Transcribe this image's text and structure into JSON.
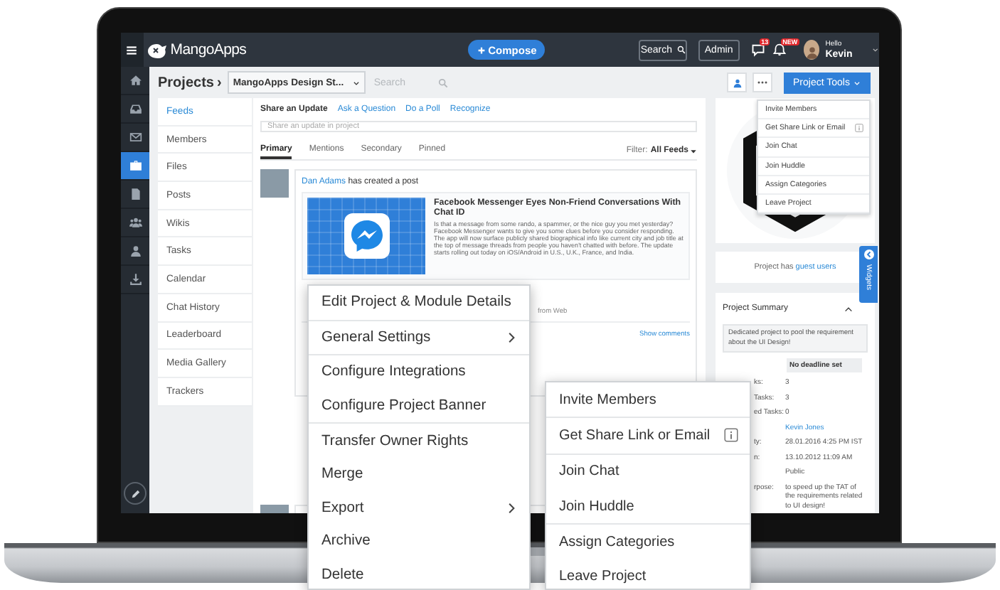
{
  "top_bar": {
    "logo": "MangoApps",
    "compose": "Compose",
    "search": "Search",
    "admin": "Admin",
    "messages_badge": "13",
    "alerts_badge": "NEW",
    "greeting": "Hello",
    "user_name": "Kevin"
  },
  "left_nav": [
    {
      "kind": "home",
      "selected": false
    },
    {
      "kind": "inbox",
      "selected": false
    },
    {
      "kind": "mail",
      "selected": false
    },
    {
      "kind": "briefcase",
      "selected": true
    },
    {
      "kind": "document",
      "selected": false
    },
    {
      "kind": "group",
      "selected": false
    },
    {
      "kind": "person",
      "selected": false
    },
    {
      "kind": "download",
      "selected": false
    }
  ],
  "project_header": {
    "title": "Projects",
    "separator": "›",
    "project": "MangoApps Design St...",
    "search_placeholder": "Search",
    "tools_button": "Project Tools"
  },
  "sidebar": {
    "items": [
      {
        "label": "Feeds",
        "selected": true
      },
      {
        "label": "Members",
        "selected": false
      },
      {
        "label": "Files",
        "selected": false
      },
      {
        "label": "Posts",
        "selected": false
      },
      {
        "label": "Wikis",
        "selected": false
      },
      {
        "label": "Tasks",
        "selected": false
      },
      {
        "label": "Calendar",
        "selected": false
      },
      {
        "label": "Chat History",
        "selected": false
      },
      {
        "label": "Leaderboard",
        "selected": false
      },
      {
        "label": "Media Gallery",
        "selected": false
      },
      {
        "label": "Trackers",
        "selected": false
      }
    ]
  },
  "composer": {
    "actions": [
      {
        "label": "Share an Update",
        "selected": true
      },
      {
        "label": "Ask a Question",
        "selected": false
      },
      {
        "label": "Do a Poll",
        "selected": false
      },
      {
        "label": "Recognize",
        "selected": false
      }
    ],
    "placeholder": "Share an update in project"
  },
  "feed_tabs": [
    {
      "label": "Primary",
      "selected": true
    },
    {
      "label": "Mentions",
      "selected": false
    },
    {
      "label": "Secondary",
      "selected": false
    },
    {
      "label": "Pinned",
      "selected": false
    }
  ],
  "filter": {
    "label": "Filter:",
    "value": "All Feeds"
  },
  "post": {
    "author": "Dan Adams",
    "action": "has created a post",
    "preview": {
      "title": "Facebook Messenger Eyes Non-Friend Conversations With Chat ID",
      "body": "Is that a message from some rando, a spammer, or the nice guy you met yesterday? Facebook Messenger wants to give you some clues before you consider responding. The app will now surface publicly shared biographical info like current city and job title at the top of message threads from people you haven't chatted with before. The update starts rolling out today on iOS/Android in U.S., U.K., France, and India."
    },
    "source": "from Web",
    "show_comments": "Show comments"
  },
  "right_panel": {
    "guest_text": "Project has",
    "guest_link": "guest users",
    "widgets_tab": "Widgets",
    "summary": {
      "title": "Project Summary",
      "expanded": true,
      "description": "Dedicated project to pool the requirement about the UI Design!",
      "deadline": "No deadline set",
      "rows": [
        {
          "label": "ks:",
          "value": "3",
          "kind": "text"
        },
        {
          "label": "Tasks:",
          "value": "3",
          "kind": "text"
        },
        {
          "label": "ed Tasks:",
          "value": "0",
          "kind": "text"
        },
        {
          "value": "Kevin Jones",
          "kind": "link"
        },
        {
          "label": "ty:",
          "value": "28.01.2016 4:25 PM IST",
          "kind": "text"
        },
        {
          "label": "n:",
          "value": "13.10.2012 11:09 AM",
          "kind": "text"
        },
        {
          "value": "Public",
          "kind": "text"
        },
        {
          "label": "rpose:",
          "value": "to speed up the TAT of the requirements related to UI design!",
          "kind": "text"
        }
      ]
    }
  },
  "tools_dropdown": {
    "items": [
      {
        "label": "Invite Members",
        "info": false
      },
      {
        "label": "Get Share Link or Email",
        "info": true
      },
      {
        "label": "Join Chat",
        "info": false
      },
      {
        "label": "Join Huddle",
        "info": false
      },
      {
        "label": "Assign Categories",
        "info": false
      },
      {
        "label": "Leave Project",
        "info": false
      }
    ]
  },
  "context_menu": {
    "groups": [
      [
        {
          "label": "Edit Project & Module Details",
          "submenu": false
        }
      ],
      [
        {
          "label": "General Settings",
          "submenu": true
        }
      ],
      [
        {
          "label": "Configure Integrations",
          "submenu": false
        },
        {
          "label": "Configure Project Banner",
          "submenu": false
        }
      ],
      [
        {
          "label": "Transfer Owner Rights",
          "submenu": false
        },
        {
          "label": "Merge",
          "submenu": false
        },
        {
          "label": "Export",
          "submenu": true
        },
        {
          "label": "Archive",
          "submenu": false
        },
        {
          "label": "Delete",
          "submenu": false
        }
      ]
    ]
  },
  "share_menu": {
    "groups": [
      [
        {
          "label": "Invite Members",
          "info": false
        }
      ],
      [
        {
          "label": "Get Share Link or Email",
          "info": true
        }
      ],
      [
        {
          "label": "Join Chat",
          "info": false
        },
        {
          "label": "Join Huddle",
          "info": false
        }
      ],
      [
        {
          "label": "Assign Categories",
          "info": false
        },
        {
          "label": "Leave Project",
          "info": false
        }
      ]
    ]
  }
}
